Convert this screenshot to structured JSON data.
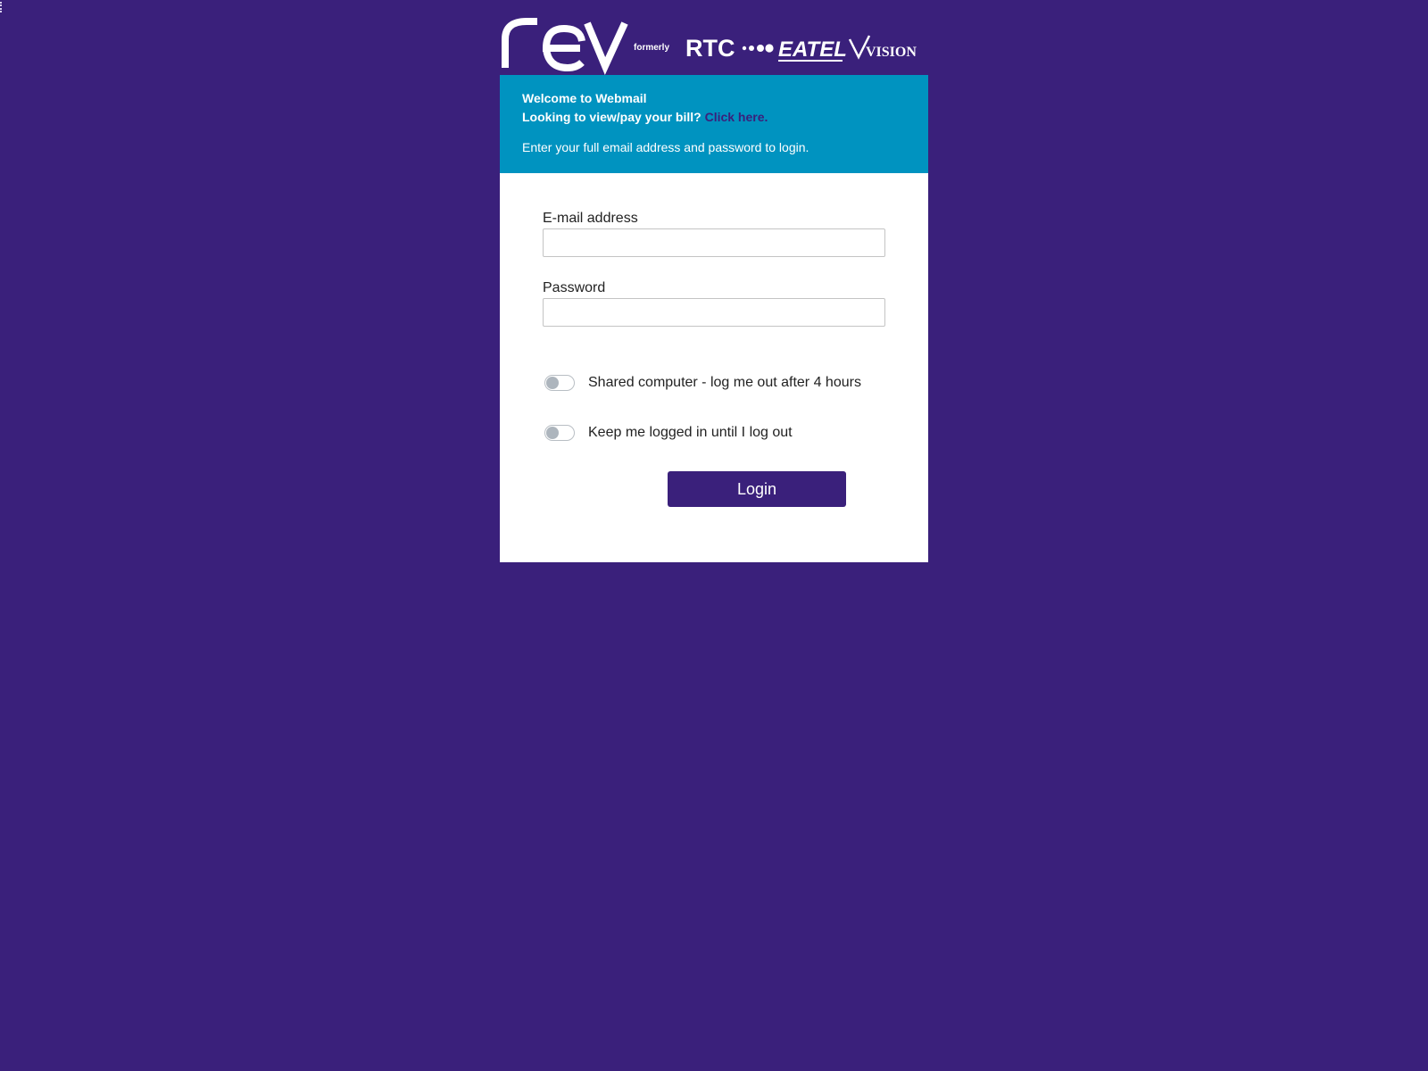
{
  "logo": {
    "brand_text": "rev",
    "formerly_text": "formerly",
    "former_brands": [
      "RTC",
      "EATEL",
      "VISION"
    ]
  },
  "banner": {
    "welcome": "Welcome to Webmail",
    "bill_prompt": "Looking to view/pay your bill?",
    "bill_link": "Click here.",
    "instructions": "Enter your full email address and password to login."
  },
  "form": {
    "email_label": "E-mail address",
    "email_value": "",
    "password_label": "Password",
    "password_value": "",
    "shared_computer_label": "Shared computer - log me out after 4 hours",
    "shared_computer_on": false,
    "keep_logged_in_label": "Keep me logged in until I log out",
    "keep_logged_in_on": false,
    "login_label": "Login"
  },
  "colors": {
    "background": "#3a207b",
    "banner": "#0093c0",
    "button": "#3a207b"
  }
}
